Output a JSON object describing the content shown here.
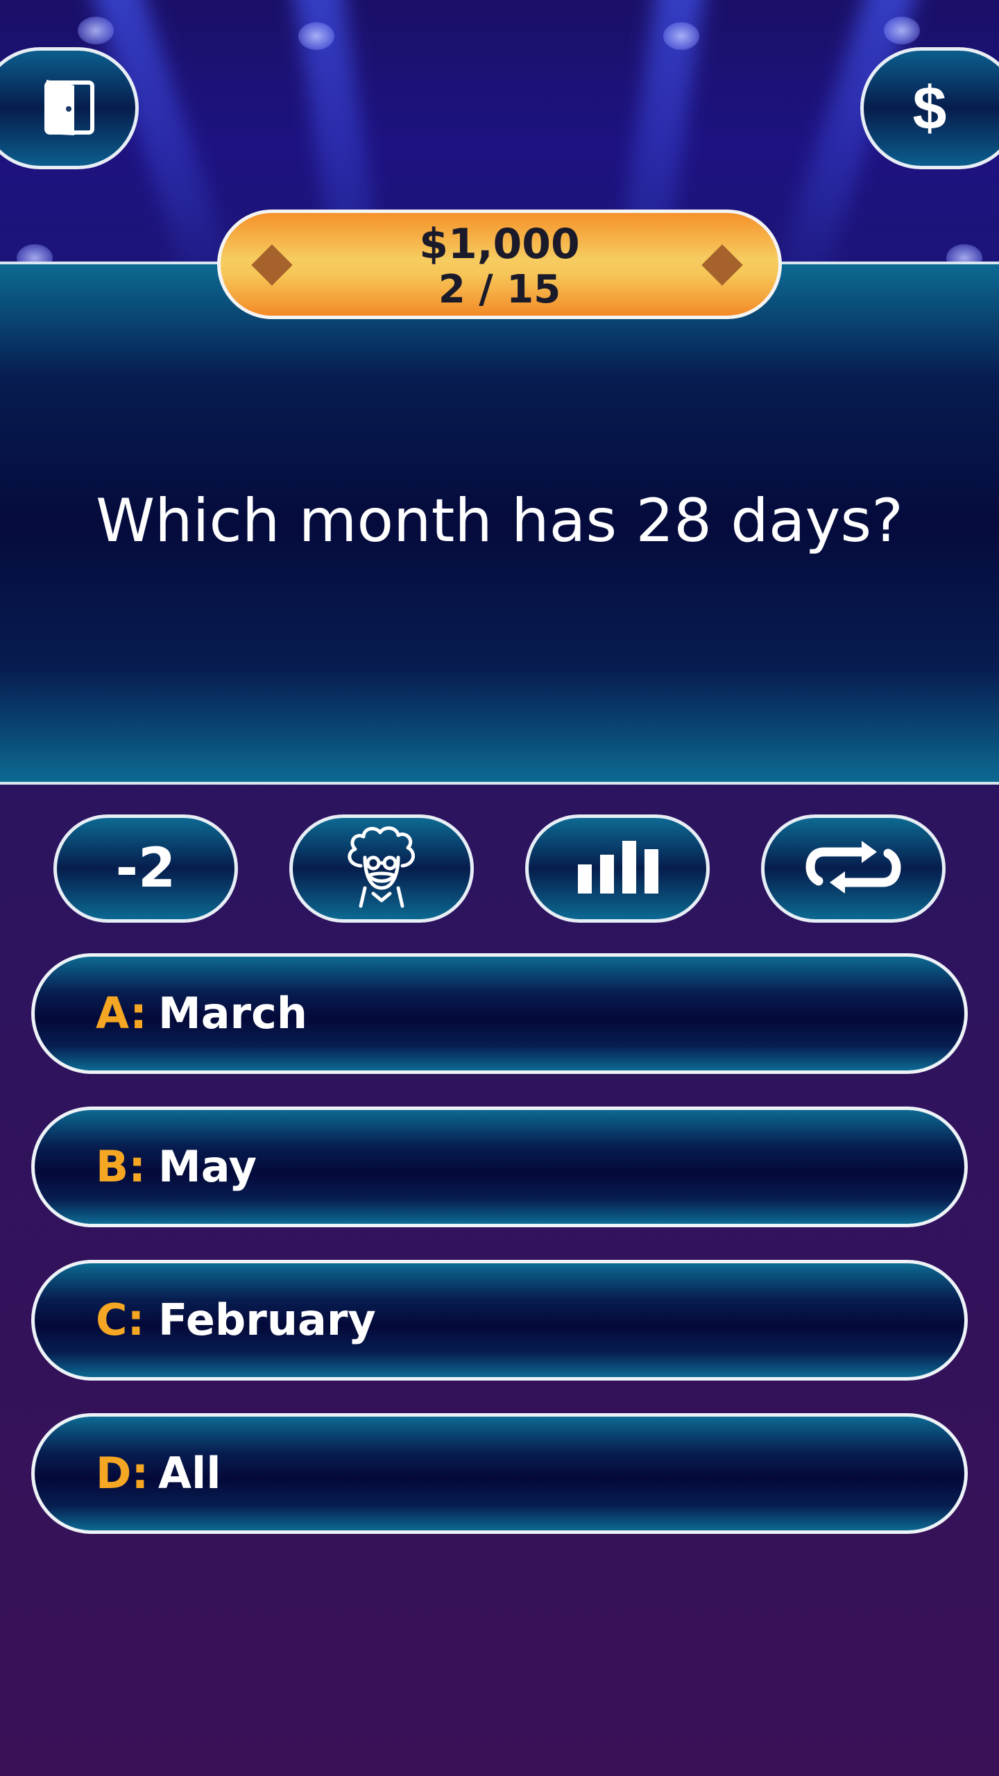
{
  "header": {
    "exit_icon": "exit-door-icon",
    "bank_label": "$"
  },
  "prize": {
    "amount": "$1,000",
    "step": "2 / 15",
    "current_question": 2,
    "total_questions": 15,
    "colors": {
      "pill": "#f6c658",
      "diamond": "#a5622a"
    }
  },
  "question": {
    "text": "Which month has 28 days?"
  },
  "lifelines": [
    {
      "name": "fifty-fifty",
      "label": "-2"
    },
    {
      "name": "ask-expert",
      "icon": "scientist-icon"
    },
    {
      "name": "audience-poll",
      "icon": "bar-chart-icon"
    },
    {
      "name": "swap-question",
      "icon": "swap-arrows-icon"
    }
  ],
  "answers": [
    {
      "letter": "A:",
      "text": "March"
    },
    {
      "letter": "B:",
      "text": "May"
    },
    {
      "letter": "C:",
      "text": "February"
    },
    {
      "letter": "D:",
      "text": "All"
    }
  ],
  "colors": {
    "answer_letter": "#f5a623",
    "panel_border": "#e8eef6",
    "background": "#2a1460"
  }
}
